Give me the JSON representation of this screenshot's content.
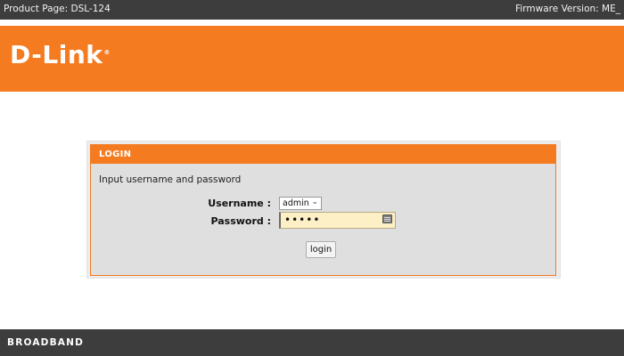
{
  "topbar": {
    "product_page": "Product Page: DSL-124",
    "firmware_version": "Firmware Version: ME_"
  },
  "banner": {
    "logo_text": "D-Link",
    "logo_mark": "®"
  },
  "login": {
    "header": "LOGIN",
    "instruction": "Input username and password",
    "username_label": "Username :",
    "username_value": "admin",
    "password_label": "Password :",
    "password_value": "•••••",
    "login_button": "login"
  },
  "footer": {
    "brand": "BROADBAND"
  },
  "colors": {
    "accent": "#f57b20",
    "dark_bar": "#3d3d3d",
    "panel_bg": "#dfdfdf",
    "password_bg": "#fdf0c6"
  },
  "icons": {
    "username_dropdown": "chevron-down-icon",
    "password_keyboard": "keyboard-icon"
  }
}
